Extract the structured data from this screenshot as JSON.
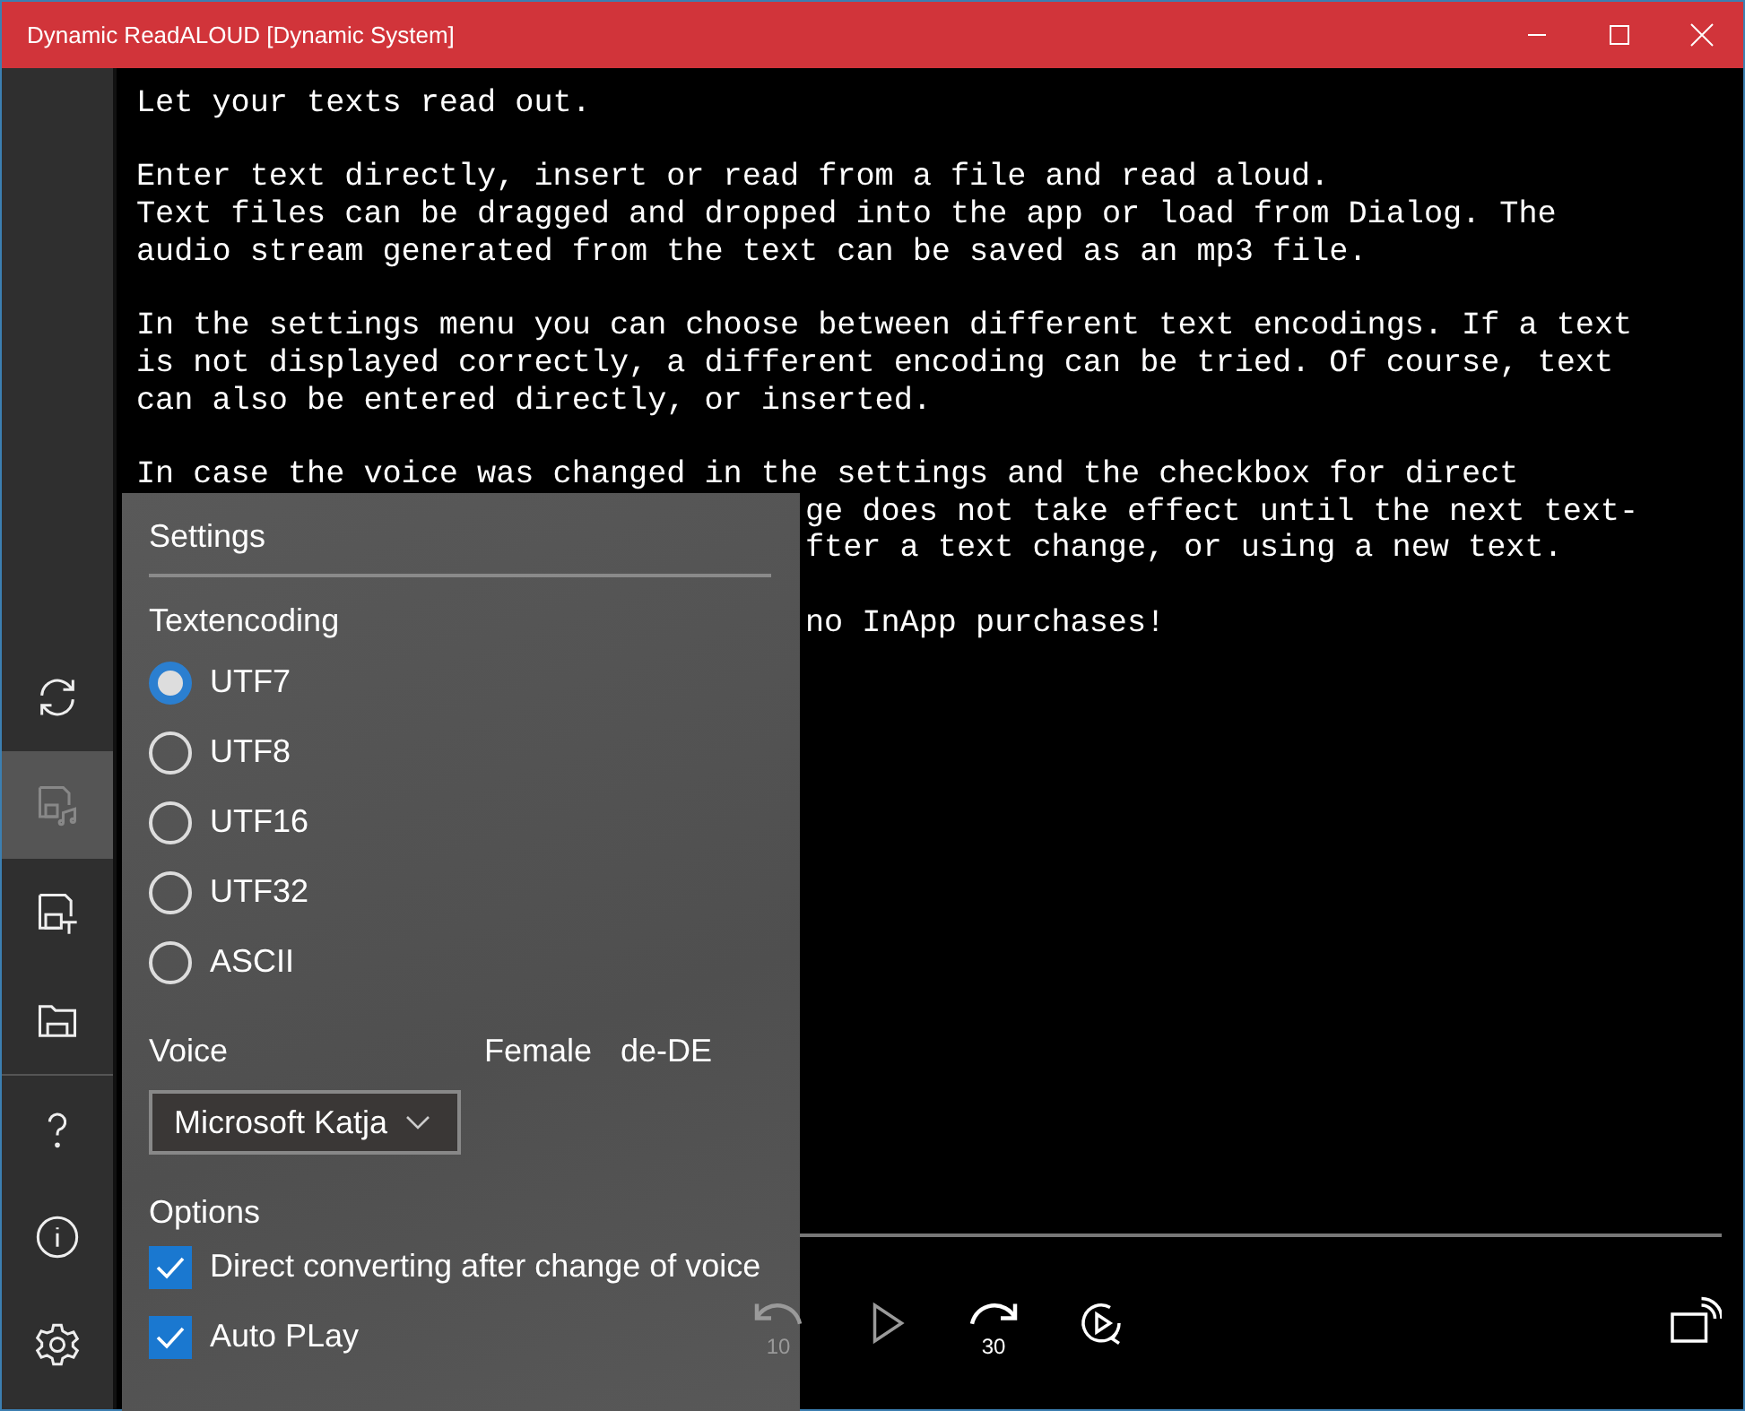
{
  "window": {
    "title": "Dynamic ReadALOUD [Dynamic System]"
  },
  "sidebar": {
    "items": [
      {
        "kind": "refresh",
        "disabled": false
      },
      {
        "kind": "save-audio",
        "disabled": true
      },
      {
        "kind": "save-text",
        "disabled": false
      },
      {
        "kind": "open",
        "disabled": false
      },
      {
        "kind": "help",
        "disabled": false
      },
      {
        "kind": "info",
        "disabled": false
      },
      {
        "kind": "settings",
        "disabled": false
      }
    ]
  },
  "text": [
    [
      {
        "text": "Let your texts read out.",
        "covered": false
      }
    ],
    [
      {
        "text": "Enter text directly, insert or read from a file and read aloud.",
        "covered": false
      },
      {
        "text": "Text files can be dragged and dropped into the app or load from Dialog. The",
        "covered": false
      },
      {
        "text": "audio stream generated from the text can be saved as an mp3 file.",
        "covered": false
      }
    ],
    [
      {
        "text": "In the settings menu you can choose between different text encodings. If a text",
        "covered": false
      },
      {
        "text": "is not displayed correctly, a different encoding can be tried. Of course, text",
        "covered": false
      },
      {
        "text": "can also be entered directly, or inserted.",
        "covered": false
      }
    ],
    [
      {
        "text": "In case the voice was changed in the settings and the checkbox for direct",
        "covered": false
      },
      {
        "text": "ge does not take effect until the next text-",
        "covered": true
      },
      {
        "text": "fter a text change, or using a new text.",
        "covered": true
      }
    ],
    [
      {
        "text": "no InApp purchases!",
        "covered": true
      }
    ]
  ],
  "player": {
    "controls": [
      {
        "kind": "replay",
        "label": "10",
        "disabled": true
      },
      {
        "kind": "play",
        "disabled": true
      },
      {
        "kind": "forward",
        "label": "30",
        "disabled": false
      },
      {
        "kind": "repeat",
        "disabled": false
      },
      {
        "kind": "cast",
        "disabled": false
      }
    ]
  },
  "settings": {
    "title": "Settings",
    "encoding_label": "Textencoding",
    "encodings": [
      {
        "label": "UTF7",
        "selected": true
      },
      {
        "label": "UTF8",
        "selected": false
      },
      {
        "label": "UTF16",
        "selected": false
      },
      {
        "label": "UTF32",
        "selected": false
      },
      {
        "label": "ASCII",
        "selected": false
      }
    ],
    "voice_label": "Voice",
    "voice_gender": "Female",
    "voice_locale": "de-DE",
    "voice": "Microsoft Katja",
    "options_label": "Options",
    "options": [
      {
        "label": "Direct converting after change of voice",
        "checked": true
      },
      {
        "label": "Auto PLay",
        "checked": true
      }
    ]
  }
}
